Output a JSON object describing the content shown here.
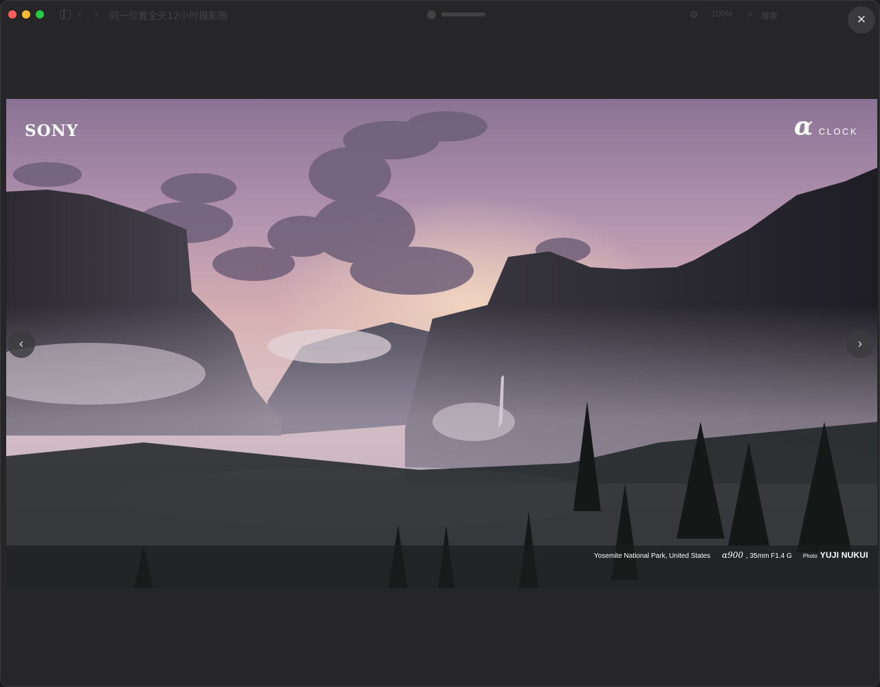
{
  "window": {
    "title": "同一位置全天12小时摄影图",
    "zoom": "100%",
    "search_label": "搜索"
  },
  "lightbox": {
    "close_icon": "close-icon",
    "prev_icon": "chevron-left-icon",
    "next_icon": "chevron-right-icon"
  },
  "photo": {
    "brand": "SONY",
    "alpha_glyph": "α",
    "clock_label": "CLOCK",
    "location": "Yosemite National Park, United States",
    "camera": "α900",
    "lens": ", 35mm F1.4 G",
    "photo_label": "Photo",
    "photographer": "YUJI NUKUI"
  },
  "colors": {
    "window_bg": "#262628",
    "close_red": "#ff5f57",
    "minimize_yellow": "#febc2e",
    "zoom_green": "#28c840"
  }
}
